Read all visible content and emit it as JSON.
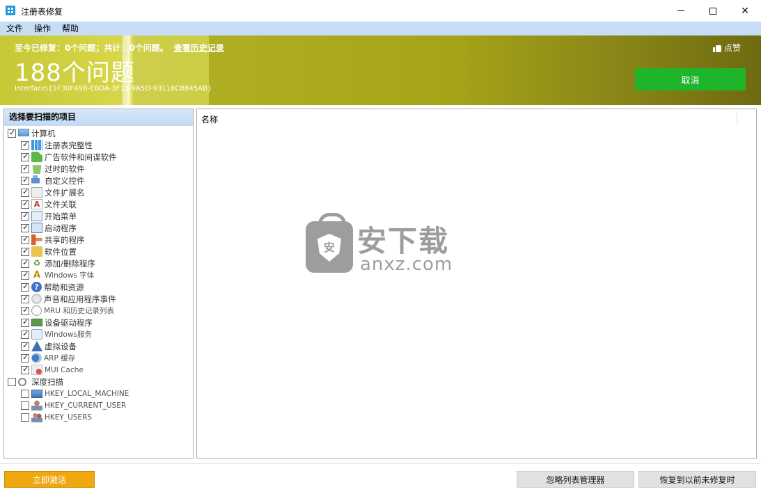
{
  "window": {
    "title": "注册表修复"
  },
  "menu": [
    "文件",
    "操作",
    "帮助"
  ],
  "banner": {
    "fixed_so_far": "至今已修复：0个问题；共计：0个问题。",
    "history_link": "查看历史记录",
    "issue_count": "188个问题",
    "scan_path": "Interface\\{1F30F49B-EBDA-3F13-9A5D-93118CB845AB}",
    "like_label": "点赞",
    "cancel_label": "取消"
  },
  "left_panel": {
    "header": "选择要扫描的项目",
    "computer": {
      "label": "计算机",
      "checked": true
    },
    "computer_items": [
      {
        "label": "注册表完整性",
        "icon": "registry-icon",
        "checked": true
      },
      {
        "label": "广告软件和间谍软件",
        "icon": "adware-icon",
        "checked": true
      },
      {
        "label": "过时的软件",
        "icon": "trash-icon",
        "checked": true
      },
      {
        "label": "自定义控件",
        "icon": "controls-icon",
        "checked": true
      },
      {
        "label": "文件扩展名",
        "icon": "file-extension-icon",
        "checked": true
      },
      {
        "label": "文件关联",
        "icon": "file-association-icon",
        "checked": true
      },
      {
        "label": "开始菜单",
        "icon": "start-menu-icon",
        "checked": true
      },
      {
        "label": "启动程序",
        "icon": "startup-icon",
        "checked": true
      },
      {
        "label": "共享的程序",
        "icon": "shared-icon",
        "checked": true
      },
      {
        "label": "软件位置",
        "icon": "folder-icon",
        "checked": true
      },
      {
        "label": "添加/删除程序",
        "icon": "recycle-icon",
        "checked": true
      },
      {
        "label": "Windows 字体",
        "icon": "font-icon",
        "checked": true
      },
      {
        "label": "帮助和资源",
        "icon": "help-icon",
        "checked": true
      },
      {
        "label": "声音和应用程序事件",
        "icon": "sound-icon",
        "checked": true
      },
      {
        "label": "MRU 和历史记录列表",
        "icon": "clock-icon",
        "checked": true
      },
      {
        "label": "设备驱动程序",
        "icon": "device-icon",
        "checked": true
      },
      {
        "label": "Windows服务",
        "icon": "service-icon",
        "checked": true
      },
      {
        "label": "虚拟设备",
        "icon": "virtual-device-icon",
        "checked": true
      },
      {
        "label": "ARP 缓存",
        "icon": "arp-icon",
        "checked": true
      },
      {
        "label": "MUI Cache",
        "icon": "mui-cache-icon",
        "checked": true
      }
    ],
    "deep_scan": {
      "label": "深度扫描",
      "checked": false
    },
    "deep_scan_items": [
      {
        "label": "HKEY_LOCAL_MACHINE",
        "icon": "hklm-icon",
        "checked": false
      },
      {
        "label": "HKEY_CURRENT_USER",
        "icon": "hkcu-icon",
        "checked": false
      },
      {
        "label": "HKEY_USERS",
        "icon": "hku-icon",
        "checked": false
      }
    ]
  },
  "results": {
    "column_name": "名称"
  },
  "watermark": {
    "cn": "安下载",
    "en": "anxz.com",
    "shield_glyph": "安"
  },
  "footer": {
    "activate_label": "立即激活",
    "ignore_label": "忽略列表管理器",
    "restore_label": "恢复到以前未修复时"
  }
}
